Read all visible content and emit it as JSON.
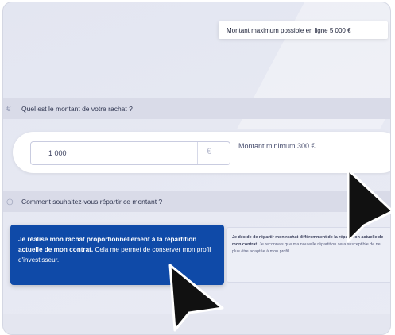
{
  "section_amount": {
    "title": "Quel est le montant de votre rachat ?",
    "input_value": "1 000",
    "currency": "€",
    "min_text": "Montant minimum 300 €",
    "max_tooltip": "Montant maximum possible en ligne 5 000 €"
  },
  "section_split": {
    "title": "Comment souhaitez-vous répartir ce montant ?",
    "option_proportional": {
      "bold": "Je réalise mon rachat proportionnellement à la répartition actuelle de mon contrat.",
      "text": " Cela me permet de conserver mon profil d'investisseur."
    },
    "option_custom": {
      "bold": "Je décide de répartir mon rachat différemment de la répartition actuelle de mon contrat.",
      "text": " Je reconnais que ma nouvelle répartition sera susceptible de ne plus être adaptée à mon profil."
    }
  },
  "colors": {
    "accent": "#0f4aa8",
    "header_bg": "#d9dbe8"
  },
  "icons": {
    "section_amount": "euro-icon",
    "section_split": "split-icon",
    "pointer": "cursor-arrow-icon"
  }
}
